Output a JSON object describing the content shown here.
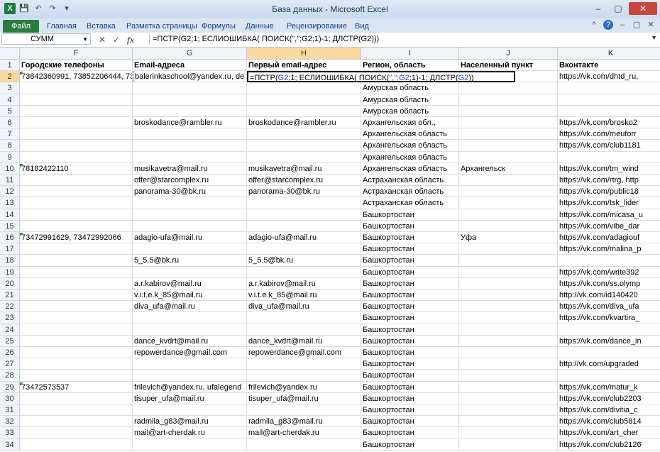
{
  "window": {
    "title": "База данных  -  Microsoft Excel",
    "app_icon": "X",
    "controls": [
      "–",
      "▢",
      "✕"
    ]
  },
  "quick_access": {
    "save_icon": "💾",
    "undo_icon": "↶",
    "redo_icon": "↷",
    "customize_icon": "▾"
  },
  "ribbon": {
    "tabs": [
      {
        "label": "Файл"
      },
      {
        "label": "Главная"
      },
      {
        "label": "Вставка"
      },
      {
        "label": "Разметка страницы"
      },
      {
        "label": "Формулы"
      },
      {
        "label": "Данные"
      },
      {
        "label": "Рецензирование"
      },
      {
        "label": "Вид"
      }
    ],
    "right_icons": [
      "^",
      "?",
      "–",
      "▢",
      "✕"
    ]
  },
  "formula_bar": {
    "name_box": "СУММ",
    "cancel": "✕",
    "enter": "✓",
    "fx": "fx",
    "formula": "=ПСТР(G2;1; ЕСЛИОШИБКА( ПОИСК(\",\";G2;1)-1; ДЛСТР(G2)))",
    "expand": "▼"
  },
  "columns": [
    {
      "letter": "F"
    },
    {
      "letter": "G"
    },
    {
      "letter": "H"
    },
    {
      "letter": "I"
    },
    {
      "letter": "J"
    },
    {
      "letter": "K"
    }
  ],
  "headers": {
    "F": "Городские телефоны",
    "G": "Email-адреса",
    "H": "Первый email-адрес",
    "I": "Регион, область",
    "J": "Населенный пункт",
    "K": "Вконтакте"
  },
  "active_cell_text": {
    "p1": "=ПСТР(",
    "p2": "G2",
    "p3": ";1; ЕСЛИОШИБКА( ПОИСК(",
    "p4": "\",\";",
    "p5": "G2",
    "p6": ";1)-1; ДЛСТР(",
    "p7": "G2",
    "p8": "))"
  },
  "rows": [
    {
      "n": "1"
    },
    {
      "n": "2",
      "F": "73842360991, 73852206444, 7385",
      "G": "balerinkaschool@yandex.ru, de",
      "I": "",
      "J": "",
      "K": "https://vk.com/dhtd_ru,"
    },
    {
      "n": "3",
      "I": "Амурская область"
    },
    {
      "n": "4",
      "I": "Амурская область"
    },
    {
      "n": "5",
      "I": "Амурская область"
    },
    {
      "n": "6",
      "G": "broskodance@rambler.ru",
      "H": "broskodance@rambler.ru",
      "I": "Архангельская обл.,",
      "K": "https://vk.com/brosko2"
    },
    {
      "n": "7",
      "I": "Архангельская область",
      "K": "https://vk.com/meuforr"
    },
    {
      "n": "8",
      "I": "Архангельская область",
      "K": "https://vk.com/club1181"
    },
    {
      "n": "9",
      "I": "Архангельская область"
    },
    {
      "n": "10",
      "F": "78182422110",
      "G": "musikavetra@mail.ru",
      "H": "musikavetra@mail.ru",
      "I": "Архангельская область",
      "J": "Архангельск",
      "K": "https://vk.com/tm_wind"
    },
    {
      "n": "11",
      "G": "offer@starcomplex.ru",
      "H": "offer@starcomplex.ru",
      "I": "Астраханская область",
      "K": "https://vk.com/rtrg, http"
    },
    {
      "n": "12",
      "G": "panorama-30@bk.ru",
      "H": "panorama-30@bk.ru",
      "I": "Астраханская область",
      "K": "https://vk.com/public18"
    },
    {
      "n": "13",
      "I": "Астраханская область",
      "K": "https://vk.com/tsk_lider"
    },
    {
      "n": "14",
      "I": "Башкортостан",
      "K": "https://vk.com/micasa_u"
    },
    {
      "n": "15",
      "I": "Башкортостан",
      "K": "https://vk.com/vibe_dar"
    },
    {
      "n": "16",
      "F": "73472991629, 73472992066",
      "G": "adagio-ufa@mail.ru",
      "H": "adagio-ufa@mail.ru",
      "I": "Башкортостан",
      "J": "Уфа",
      "K": "https://vk.com/adagiouf"
    },
    {
      "n": "17",
      "I": "Башкортостан",
      "K": "https://vk.com/malina_p"
    },
    {
      "n": "18",
      "G": "5_5.5@bk.ru",
      "H": "5_5.5@bk.ru",
      "I": "Башкортостан"
    },
    {
      "n": "19",
      "I": "Башкортостан",
      "K": "https://vk.com/write392"
    },
    {
      "n": "20",
      "G": "a.r.kabirov@mail.ru",
      "H": "a.r.kabirov@mail.ru",
      "I": "Башкортостан",
      "K": "https://vk.com/ss.olymp"
    },
    {
      "n": "21",
      "G": "v.i.t.e.k_85@mail.ru",
      "H": "v.i.t.e.k_85@mail.ru",
      "I": "Башкортостан",
      "K": "http://vk.com/id140420"
    },
    {
      "n": "22",
      "G": "diva_ufa@mail.ru",
      "H": "diva_ufa@mail.ru",
      "I": "Башкортостан",
      "K": "https://vk.com/diva_ufa"
    },
    {
      "n": "23",
      "I": "Башкортостан",
      "K": "https://vk.com/kvartira_"
    },
    {
      "n": "24",
      "I": "Башкортостан"
    },
    {
      "n": "25",
      "G": "dance_kvdrt@mail.ru",
      "H": "dance_kvdrt@mail.ru",
      "I": "Башкортостан",
      "K": "https://vk.com/dance_in"
    },
    {
      "n": "26",
      "G": "repowerdance@gmail.com",
      "H": "repowerdance@gmail.com",
      "I": "Башкортостан"
    },
    {
      "n": "27",
      "I": "Башкортостан",
      "K": "http://vk.com/upgraded"
    },
    {
      "n": "28",
      "I": "Башкортостан"
    },
    {
      "n": "29",
      "F": "73472573537",
      "G": "frilevich@yandex.ru, ufalegend",
      "H": "frilevich@yandex.ru",
      "I": "Башкортостан",
      "K": "https://vk.com/matur_k"
    },
    {
      "n": "30",
      "G": "tisuper_ufa@mail.ru",
      "H": "tisuper_ufa@mail.ru",
      "I": "Башкортостан",
      "K": "https://vk.com/club2203"
    },
    {
      "n": "31",
      "I": "Башкортостан",
      "K": "https://vk.com/divitia_c"
    },
    {
      "n": "32",
      "G": "radmila_g83@mail.ru",
      "H": "radmila_g83@mail.ru",
      "I": "Башкортостан",
      "K": "https://vk.com/club5814"
    },
    {
      "n": "33",
      "G": "mail@art-cherdak.ru",
      "H": "mail@art-cherdak.ru",
      "I": "Башкортостан",
      "K": "https://vk.com/art_cher"
    },
    {
      "n": "34",
      "I": "Башкортостан",
      "K": "https://vk.com/club2126"
    }
  ]
}
